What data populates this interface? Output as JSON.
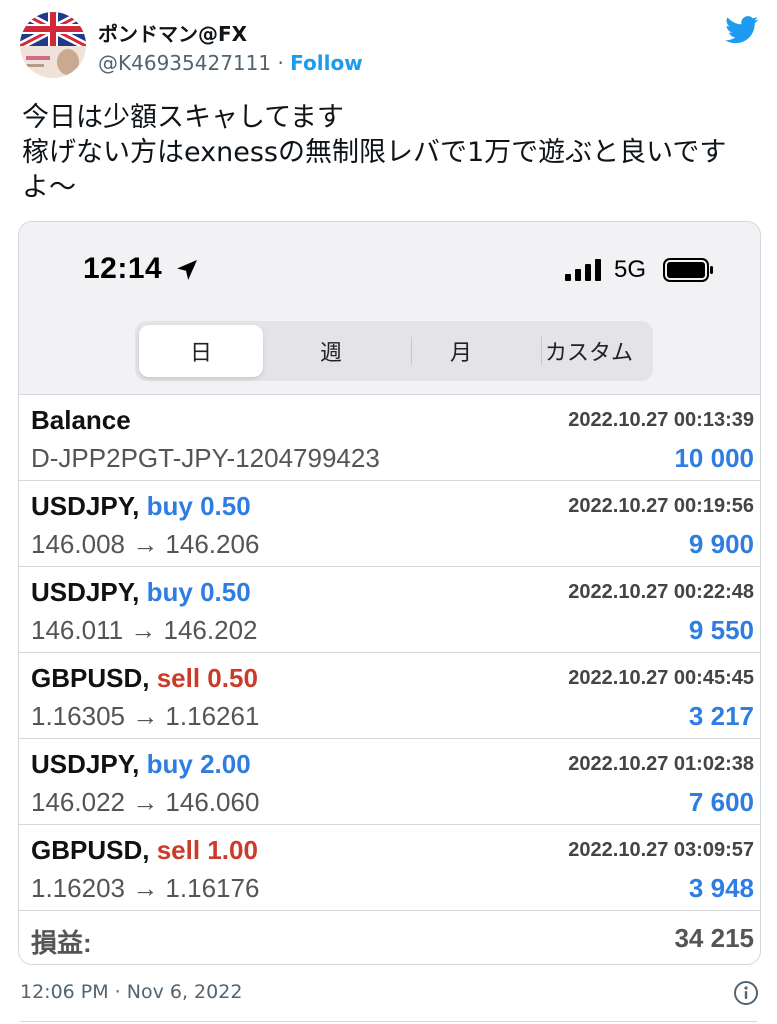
{
  "tweet": {
    "display_name": "ポンドマン@FX",
    "handle": "@K46935427111",
    "separator": " · ",
    "follow_label": "Follow",
    "text": "今日は少額スキャしてます\n稼げない方はexnessの無制限レバで1万で遊ぶと良いです\nよ〜",
    "timestamp": "12:06 PM · Nov 6, 2022"
  },
  "icons": {
    "logo": "twitter-bird-icon",
    "avatar": "union-jack-banknote-avatar",
    "info": "info-icon",
    "location": "location-arrow-icon",
    "signal": "signal-bars-icon",
    "battery": "battery-icon"
  },
  "colors": {
    "twitter_blue": "#1d9bf0",
    "buy_blue": "#2f7de1",
    "sell_red": "#cc3a2a",
    "value_blue": "#2f7de1"
  },
  "phone": {
    "status": {
      "time": "12:14",
      "network": "5G"
    },
    "tabs": [
      {
        "label": "日",
        "selected": true
      },
      {
        "label": "週",
        "selected": false
      },
      {
        "label": "月",
        "selected": false
      },
      {
        "label": "カスタム",
        "selected": false
      }
    ],
    "balance": {
      "title": "Balance",
      "account": "D-JPP2PGT-JPY-1204799423",
      "date": "2022.10.27 00:13:39",
      "value": "10 000"
    },
    "trades": [
      {
        "symbol": "USDJPY,",
        "action": "buy 0.50",
        "side": "buy",
        "prices": "146.008 → 146.206",
        "date": "2022.10.27 00:19:56",
        "profit": "9 900"
      },
      {
        "symbol": "USDJPY,",
        "action": "buy 0.50",
        "side": "buy",
        "prices": "146.011 → 146.202",
        "date": "2022.10.27 00:22:48",
        "profit": "9 550"
      },
      {
        "symbol": "GBPUSD,",
        "action": "sell 0.50",
        "side": "sell",
        "prices": "1.16305 → 1.16261",
        "date": "2022.10.27 00:45:45",
        "profit": "3 217"
      },
      {
        "symbol": "USDJPY,",
        "action": "buy 2.00",
        "side": "buy",
        "prices": "146.022 → 146.060",
        "date": "2022.10.27 01:02:38",
        "profit": "7 600"
      },
      {
        "symbol": "GBPUSD,",
        "action": "sell 1.00",
        "side": "sell",
        "prices": "1.16203 → 1.16176",
        "date": "2022.10.27 03:09:57",
        "profit": "3 948"
      }
    ],
    "total": {
      "label": "損益:",
      "value": "34 215"
    }
  }
}
